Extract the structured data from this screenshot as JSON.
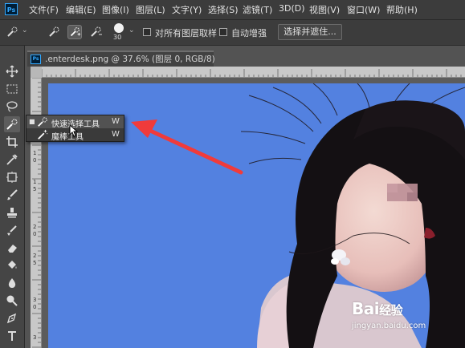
{
  "app": {
    "logo_text": "Ps"
  },
  "menu": [
    "文件(F)",
    "编辑(E)",
    "图像(I)",
    "图层(L)",
    "文字(Y)",
    "选择(S)",
    "滤镜(T)",
    "3D(D)",
    "视图(V)",
    "窗口(W)",
    "帮助(H)"
  ],
  "options": {
    "brush_size": "30",
    "sample_all_layers_label": "对所有图层取样",
    "sample_all_layers_checked": false,
    "auto_enhance_label": "自动增强",
    "auto_enhance_checked": false,
    "select_mask_button": "选择并遮住..."
  },
  "document_tab": {
    "icon_text": "Ps",
    "title": ".enterdesk.png @ 37.6% (图层 0, RGB/8)"
  },
  "rulers": {
    "vertical_labels": [
      "1",
      "0",
      "1",
      "5",
      "2",
      "0",
      "2",
      "5",
      "3",
      "0",
      "3"
    ]
  },
  "tools": [
    "move-tool",
    "marquee-tool",
    "lasso-tool",
    "quick-selection-tool",
    "crop-tool",
    "eyedropper-tool",
    "frame-tool",
    "brush-tool",
    "stamp-tool",
    "history-brush-tool",
    "eraser-tool",
    "paint-bucket-tool",
    "blur-tool",
    "dodge-tool",
    "pen-tool",
    "type-tool",
    "path-select-tool"
  ],
  "flyout": {
    "items": [
      {
        "label": "快速选择工具",
        "shortcut": "W",
        "selected": true,
        "icon": "quick-selection-icon"
      },
      {
        "label": "魔棒工具",
        "shortcut": "W",
        "selected": false,
        "icon": "magic-wand-icon"
      }
    ]
  },
  "watermark": {
    "brand_prefix": "Bai",
    "brand_suffix": "经验",
    "url": "jingyan.baidu.com"
  },
  "colors": {
    "background_sky": "#5381e0",
    "arrow": "#f03b3b",
    "accent": "#31a8ff"
  }
}
